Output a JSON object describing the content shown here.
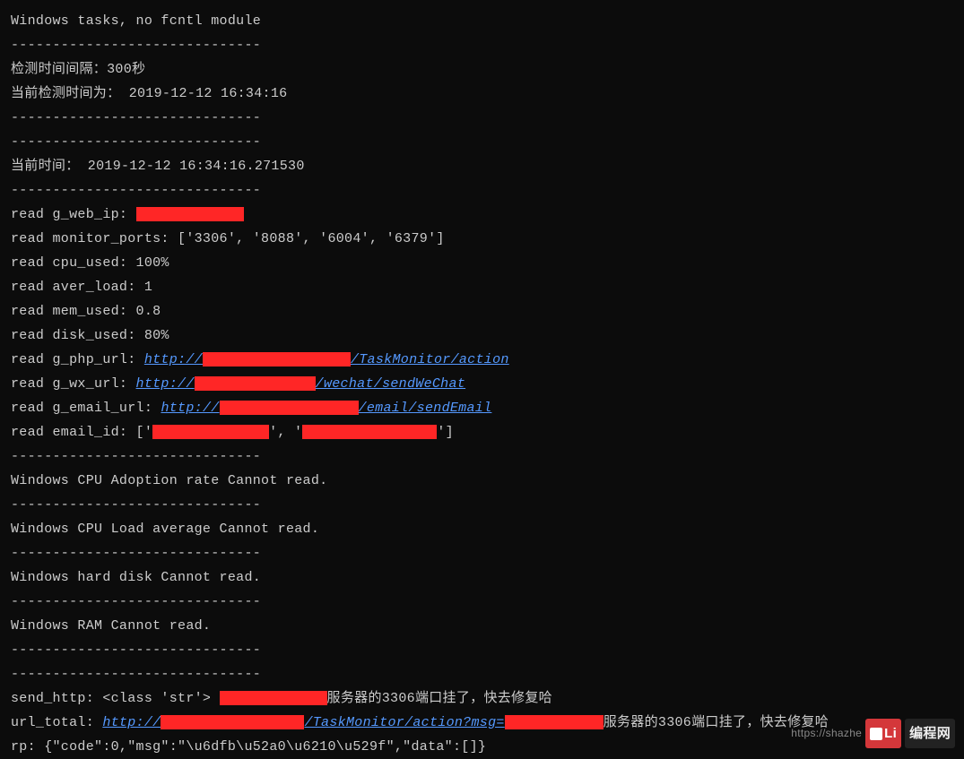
{
  "header": {
    "title": "Windows tasks, no fcntl module",
    "divider": "------------------------------"
  },
  "check": {
    "interval": "检测时间间隔：300秒",
    "current_check_time": "当前检测时间为： 2019-12-12 16:34:16",
    "divider": "------------------------------",
    "divider2": "------------------------------"
  },
  "time": {
    "current_time": "当前时间： 2019-12-12 16:34:16.271530",
    "divider": "------------------------------"
  },
  "reads": {
    "web_ip_label": "read g_web_ip: ",
    "monitor_ports": "read monitor_ports: ['3306', '8088', '6004', '6379']",
    "cpu_used": "read cpu_used: 100%",
    "aver_load": "read aver_load: 1",
    "mem_used": "read mem_used: 0.8",
    "disk_used": "read disk_used: 80%",
    "php_url_label": "read g_php_url: ",
    "php_url_prefix": "http://",
    "php_url_suffix": "/TaskMonitor/action",
    "wx_url_label": "read g_wx_url: ",
    "wx_url_prefix": "http://",
    "wx_url_suffix": "/wechat/sendWeChat",
    "email_url_label": "read g_email_url: ",
    "email_url_prefix": "http://",
    "email_url_suffix": "/email/sendEmail",
    "email_id_label": "read email_id: ['",
    "email_id_sep": "', '",
    "email_id_end": "']",
    "divider": "------------------------------"
  },
  "errors": {
    "cpu_adoption": "Windows CPU Adoption rate Cannot read.",
    "cpu_load": "Windows CPU Load average Cannot read.",
    "hard_disk": "Windows hard disk Cannot read.",
    "ram": "Windows RAM Cannot read.",
    "divider": "------------------------------",
    "divider_final": "------------------------------"
  },
  "send": {
    "http_label": "send_http: <class 'str'> ",
    "http_suffix": "服务器的3306端口挂了，快去修复哈",
    "url_total_label": "url_total: ",
    "url_total_prefix": "http://",
    "url_total_mid": "/TaskMonitor/action?msg=",
    "url_total_suffix": "服务器的3306端口挂了，快去修复哈",
    "rp": "rp: {\"code\":0,\"msg\":\"\\u6dfb\\u52a0\\u6210\\u529f\",\"data\":[]}"
  },
  "watermark": {
    "url": "https://shazhenyu.blog.csdn.net",
    "brand_red": "Li",
    "brand_cn": "编程网"
  }
}
